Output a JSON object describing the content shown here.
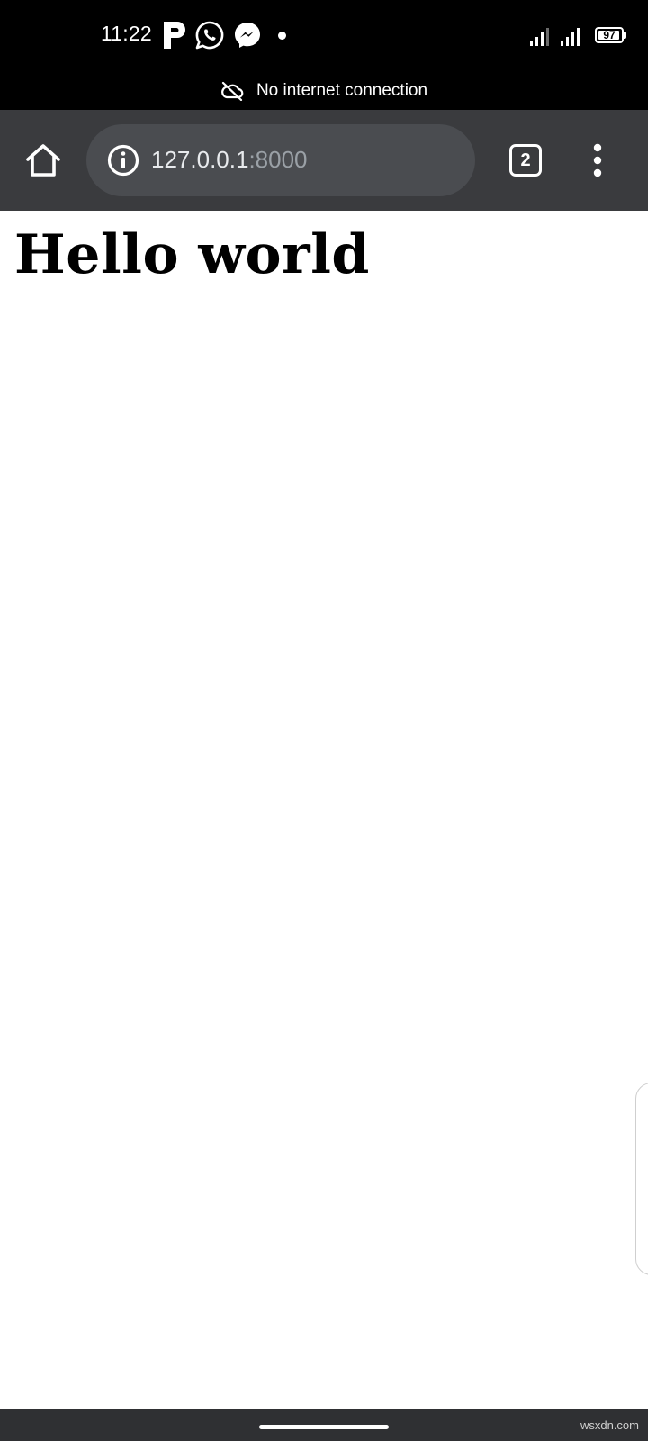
{
  "status_bar": {
    "time": "11:22",
    "battery_percent": "97",
    "battery_level": 0.97,
    "icons": [
      "parking-p-icon",
      "whatsapp-icon",
      "messenger-icon",
      "notification-dot",
      "signal-icon",
      "signal-icon",
      "battery-icon"
    ],
    "network_message": "No internet connection",
    "network_icon": "cloud-off-icon"
  },
  "toolbar": {
    "url_host": "127.0.0.1",
    "url_port": ":8000",
    "tab_count": "2",
    "icons": [
      "home-icon",
      "info-icon",
      "tab-switcher-icon",
      "more-vert-icon"
    ]
  },
  "page": {
    "heading": "Hello world"
  },
  "watermark": "wsxdn.com",
  "colors": {
    "status_bar_bg": "#000000",
    "toolbar_bg": "#3a3b3e",
    "url_bar_bg": "#4a4c50",
    "url_port_color": "#9aa0a6",
    "page_bg": "#ffffff",
    "nav_bar_bg": "#2f3033"
  }
}
